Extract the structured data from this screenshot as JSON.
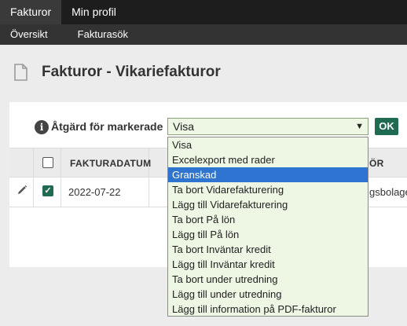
{
  "topnav": {
    "tabs": [
      {
        "label": "Fakturor",
        "active": true
      },
      {
        "label": "Min profil",
        "active": false
      }
    ]
  },
  "subnav": {
    "items": [
      {
        "label": "Översikt"
      },
      {
        "label": "Fakturasök"
      }
    ]
  },
  "page": {
    "title": "Fakturor - Vikariefakturor",
    "icon": "document-icon"
  },
  "action": {
    "label": "Åtgärd för markerade",
    "selected": "Visa",
    "ok_label": "OK",
    "info_icon_glyph": "i",
    "options": [
      "Visa",
      "Excelexport med rader",
      "Granskad",
      "Ta bort Vidarefakturering",
      "Lägg till Vidarefakturering",
      "Ta bort På lön",
      "Lägg till På lön",
      "Ta bort Inväntar kredit",
      "Lägg till Inväntar kredit",
      "Ta bort under utredning",
      "Lägg till under utredning",
      "Lägg till information på PDF-fakturor"
    ],
    "highlighted": "Granskad"
  },
  "table": {
    "columns": {
      "date": "FAKTURADATUM",
      "right": "ÖR"
    },
    "rows": [
      {
        "date": "2022-07-22",
        "right": "gsbolage",
        "checked": true
      }
    ]
  },
  "colors": {
    "topnav_bg": "#1d1d1d",
    "subnav_bg": "#333333",
    "accent": "#1e6b52",
    "select_bg": "#eef6e4",
    "highlight": "#2f74d0"
  }
}
